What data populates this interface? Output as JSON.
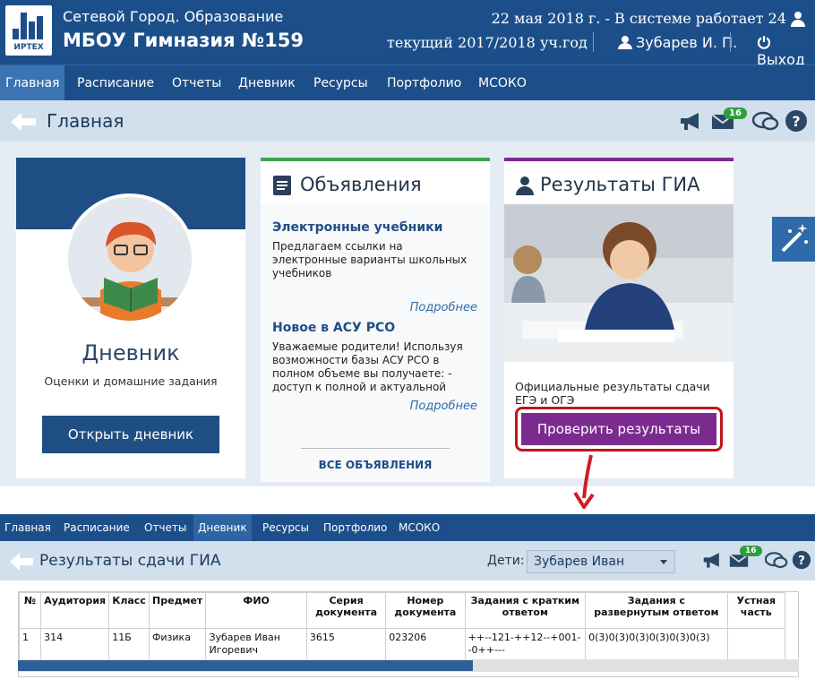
{
  "header": {
    "city": "Сетевой Город. Образование",
    "school": "МБОУ Гимназия №159",
    "date_line": "22 мая 2018 г. - В системе работает 24",
    "year": "текущий 2017/2018 уч.год",
    "user": "Зубарев И. П.",
    "exit": "Выход",
    "logo_text": "ИРТЕХ"
  },
  "nav": [
    "Главная",
    "Расписание",
    "Отчеты",
    "Дневник",
    "Ресурсы",
    "Портфолио",
    "МСОКО"
  ],
  "subbar": {
    "title": "Главная",
    "badge": "16"
  },
  "diary_card": {
    "title": "Дневник",
    "subtitle": "Оценки и домашние задания",
    "button": "Открыть дневник"
  },
  "announcements": {
    "title": "Объявления",
    "items": [
      {
        "title": "Электронные учебники",
        "body": "Предлагаем ссылки на электронные варианты школьных учебников",
        "more": "Подробнее"
      },
      {
        "title": "Новое в АСУ РСО",
        "body": "Уважаемые родители!  Используя возможности базы АСУ РСО в полном объеме вы получаете: - доступ к полной и актуальной",
        "more": "Подробнее"
      }
    ],
    "all": "ВСЕ ОБЪЯВЛЕНИЯ"
  },
  "gia_card": {
    "title": "Результаты ГИА",
    "desc": "Официальные результаты сдачи ЕГЭ и ОГЭ",
    "button": "Проверить результаты"
  },
  "nav2": [
    "Главная",
    "Расписание",
    "Отчеты",
    "Дневник",
    "Ресурсы",
    "Портфолио",
    "МСОКО"
  ],
  "sub2": {
    "title": "Результаты сдачи ГИА",
    "kids_label": "Дети:",
    "kids_value": "Зубарев Иван",
    "badge": "16"
  },
  "table": {
    "headers": [
      "№",
      "Аудитория",
      "Класс",
      "Предмет",
      "ФИО",
      "Серия документа",
      "Номер документа",
      "Задания с кратким ответом",
      "Задания с развернутым ответом",
      "Устная часть"
    ],
    "rows": [
      [
        "1",
        "314",
        "11Б",
        "Физика",
        "Зубарев Иван Игоревич",
        "3615",
        "023206",
        "++--121-++12--+001--0++---",
        "0(3)0(3)0(3)0(3)0(3)0(3)",
        ""
      ]
    ]
  },
  "colors": {
    "primary": "#1c4f8a",
    "green": "#3fa34d",
    "purple": "#7b2b90",
    "highlight": "#c0151c"
  }
}
